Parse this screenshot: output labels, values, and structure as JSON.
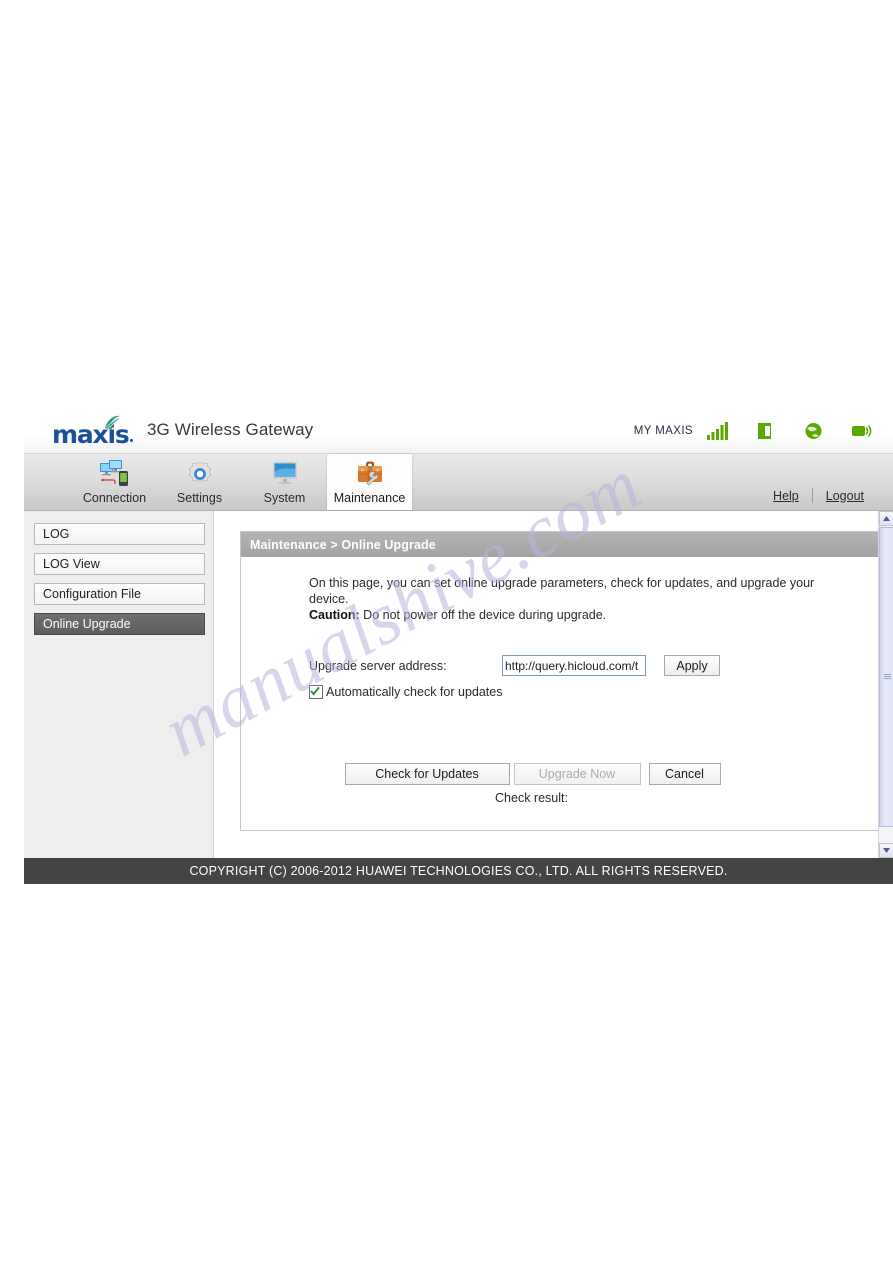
{
  "watermark": {
    "text": "manualshive.com"
  },
  "brand": {
    "logo_text": "maxis",
    "logo_icon": "maxis-swoosh-icon",
    "app_title": "3G Wireless Gateway",
    "carrier": "MY MAXIS",
    "status_icons": [
      {
        "name": "signal-bars-icon",
        "color": "#5aa800"
      },
      {
        "name": "sim-card-icon",
        "color": "#5aa800"
      },
      {
        "name": "globe-internet-icon",
        "color": "#5aa800"
      },
      {
        "name": "wifi-broadcast-icon",
        "color": "#5aa800"
      }
    ]
  },
  "tabs": [
    {
      "label": "Connection",
      "icon": "monitors-phone-icon",
      "active": false
    },
    {
      "label": "Settings",
      "icon": "gear-icon",
      "active": false
    },
    {
      "label": "System",
      "icon": "monitor-icon",
      "active": false
    },
    {
      "label": "Maintenance",
      "icon": "toolbox-wrench-icon",
      "active": true
    }
  ],
  "toplinks": {
    "help": "Help",
    "logout": "Logout"
  },
  "sidebar": {
    "items": [
      {
        "label": "LOG",
        "active": false
      },
      {
        "label": "LOG View",
        "active": false
      },
      {
        "label": "Configuration File",
        "active": false
      },
      {
        "label": "Online Upgrade",
        "active": true
      }
    ]
  },
  "panel": {
    "title": "Maintenance > Online Upgrade",
    "intro_line1": "On this page, you can set online upgrade parameters, check for updates, and upgrade your device.",
    "caution_label": "Caution:",
    "caution_text": " Do not power off the device during upgrade.",
    "server_label": "Upgrade server address:",
    "server_value": "http://query.hicloud.com/t",
    "server_placeholder": "http://query.hicloud.com/t",
    "apply_label": "Apply",
    "autocheck_label": "Automatically check for updates",
    "autocheck_checked": true,
    "check_updates_label": "Check for Updates",
    "upgrade_now_label": "Upgrade Now",
    "upgrade_now_disabled": true,
    "cancel_label": "Cancel",
    "check_result_label": "Check result:"
  },
  "footer": {
    "copyright": "COPYRIGHT (C) 2006-2012 HUAWEI TECHNOLOGIES CO., LTD. ALL RIGHTS RESERVED."
  },
  "colors": {
    "brand_blue": "#19519b",
    "status_green": "#5aa800",
    "footer_bg": "#444444",
    "panel_head_bg": "#a9a9a9",
    "active_nav_bg": "#656565"
  }
}
